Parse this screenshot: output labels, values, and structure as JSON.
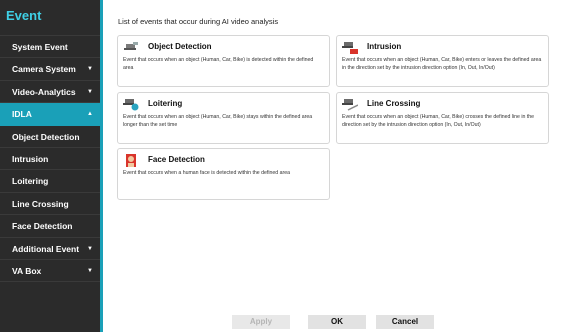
{
  "sidebar": {
    "title": "Event",
    "items": [
      {
        "label": "System Event",
        "chevron": false
      },
      {
        "label": "Camera System",
        "chevron": true
      },
      {
        "label": "Video-Analytics",
        "chevron": true
      },
      {
        "label": "IDLA",
        "chevron": true,
        "active": true
      },
      {
        "label": "Object Detection"
      },
      {
        "label": "Intrusion"
      },
      {
        "label": "Loitering"
      },
      {
        "label": "Line Crossing"
      },
      {
        "label": "Face Detection"
      },
      {
        "label": "Additional Event",
        "chevron": true
      },
      {
        "label": "VA Box",
        "chevron": true
      }
    ]
  },
  "main": {
    "heading": "List of events that occur during AI video analysis",
    "cards": [
      {
        "title": "Object Detection",
        "icon": "object-detection-icon",
        "description": "Event that occurs when an object (Human, Car, Bike) is detected within the defined area"
      },
      {
        "title": "Intrusion",
        "icon": "intrusion-icon",
        "description": "Event that occurs when an object (Human, Car, Bike) enters or leaves the defined area in the direction set by the intrusion direction option (In, Out, In/Out)"
      },
      {
        "title": "Loitering",
        "icon": "loitering-icon",
        "description": "Event that occurs when an object (Human, Car, Bike) stays within the defined area longer than the set time"
      },
      {
        "title": "Line Crossing",
        "icon": "line-crossing-icon",
        "description": "Event that occurs when an object (Human, Car, Bike) crosses the defined line in the direction set by the intrusion direction option (In, Out, In/Out)"
      },
      {
        "title": "Face Detection",
        "icon": "face-detection-icon",
        "description": "Event that occurs when a human face is detected within the defined area"
      }
    ]
  },
  "buttons": {
    "apply": "Apply",
    "ok": "OK",
    "cancel": "Cancel"
  },
  "colors": {
    "accent": "#1aa0b8",
    "sidebar_bg": "#2b2b2b",
    "title": "#3fd0e6"
  }
}
